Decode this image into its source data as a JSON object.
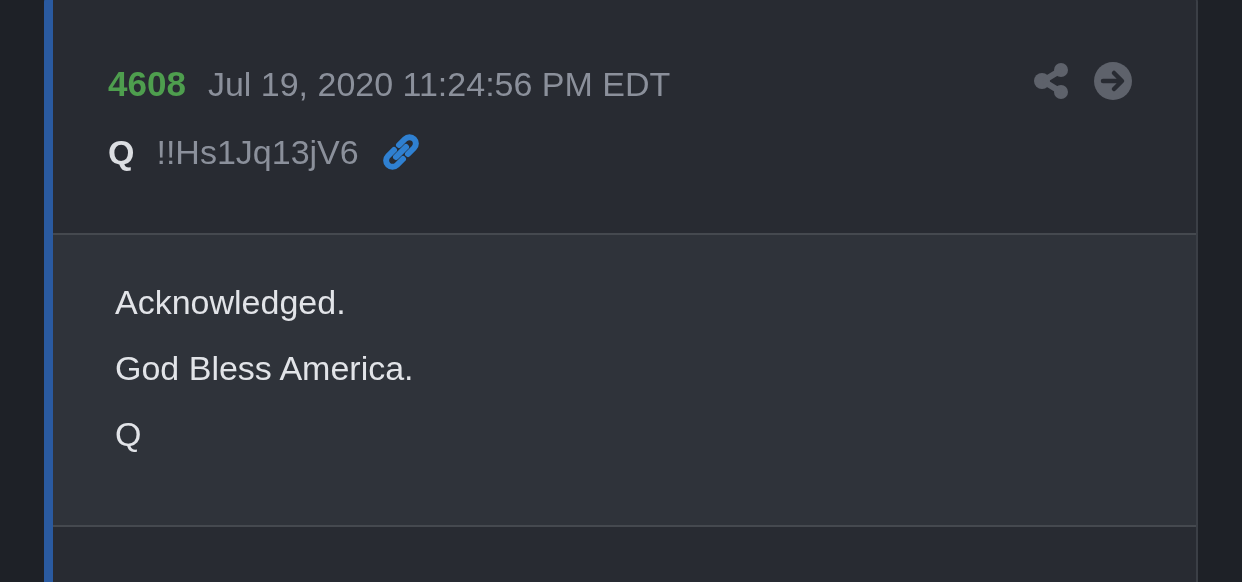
{
  "post": {
    "number": "4608",
    "timestamp": "Jul 19, 2020 11:24:56 PM EDT",
    "author": "Q",
    "tripcode": "!!Hs1Jq13jV6",
    "lines": [
      "Acknowledged.",
      "God Bless America.",
      "Q"
    ]
  }
}
